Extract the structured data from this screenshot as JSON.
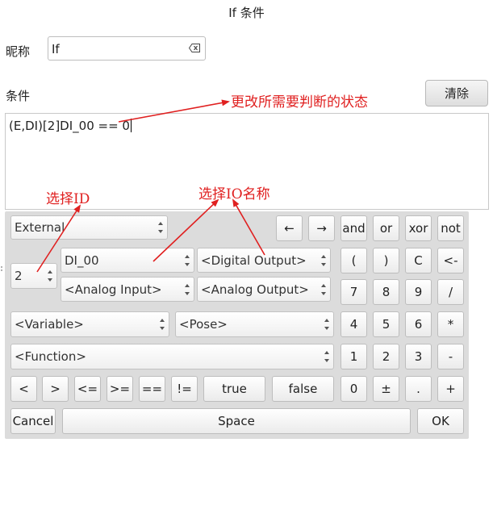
{
  "window": {
    "title": "If 条件"
  },
  "nickname": {
    "label": "昵称",
    "value": "If"
  },
  "condition": {
    "label": "条件",
    "value": "(E,DI)[2]DI_00 == 0",
    "clear_label": "清除"
  },
  "annotations": {
    "change_state": "更改所需要判断的状态",
    "select_id": "选择ID",
    "select_io_name": "选择IO名称"
  },
  "keypad": {
    "source_select": "External",
    "id_spin": "2",
    "io_select": "DI_00",
    "digital_output": "<Digital Output>",
    "analog_input": "<Analog Input>",
    "analog_output": "<Analog Output>",
    "variable": "<Variable>",
    "pose": "<Pose>",
    "function": "<Function>",
    "row1": [
      "←",
      "→",
      "and",
      "or",
      "xor",
      "not"
    ],
    "row2": [
      "(",
      ")",
      "C",
      "<-"
    ],
    "row3": [
      "7",
      "8",
      "9",
      "/"
    ],
    "row4": [
      "4",
      "5",
      "6",
      "*"
    ],
    "row5": [
      "1",
      "2",
      "3",
      "-"
    ],
    "ops": [
      "<",
      ">",
      "<=",
      ">=",
      "==",
      "!=",
      "true",
      "false"
    ],
    "row6": [
      "0",
      "±",
      ".",
      "+"
    ],
    "cancel": "Cancel",
    "space": "Space",
    "ok": "OK"
  }
}
